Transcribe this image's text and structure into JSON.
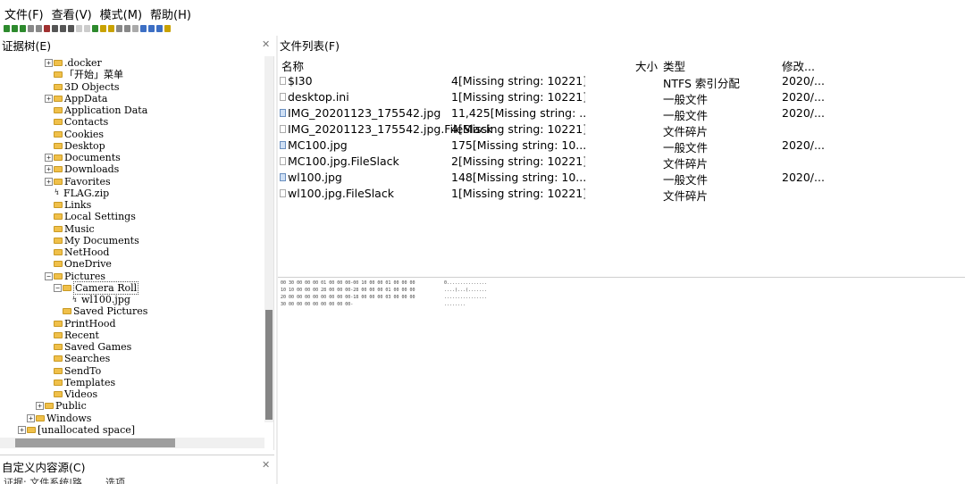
{
  "menubar": {
    "items": [
      "文件(F)",
      "查看(V)",
      "模式(M)",
      "帮助(H)"
    ]
  },
  "toolbar": {
    "buttons": [
      {
        "icon": "home-icon",
        "color": "#2d8a2d"
      },
      {
        "icon": "back-icon",
        "color": "#2d8a2d"
      },
      {
        "icon": "forward-icon",
        "color": "#2d8a2d"
      },
      {
        "icon": "copy-icon",
        "color": "#888888"
      },
      {
        "icon": "search-icon",
        "color": "#888888"
      },
      {
        "icon": "find-icon",
        "color": "#a03030"
      },
      {
        "icon": "save-icon",
        "color": "#555555"
      },
      {
        "icon": "export-icon",
        "color": "#555555"
      },
      {
        "icon": "print-icon",
        "color": "#555555"
      },
      {
        "icon": "cloud-icon",
        "color": "#cccccc"
      },
      {
        "icon": "arrow-icon",
        "color": "#cccccc"
      },
      {
        "icon": "bar-icon",
        "color": "#2d8a2d"
      },
      {
        "icon": "bookmark-icon",
        "color": "#c9a200"
      },
      {
        "icon": "pencil-icon",
        "color": "#c9a200"
      },
      {
        "icon": "page-icon",
        "color": "#888888"
      },
      {
        "icon": "page2-icon",
        "color": "#888888"
      },
      {
        "icon": "page3-icon",
        "color": "#aaaaaa"
      },
      {
        "icon": "view-hex-icon",
        "color": "#3d6fc4"
      },
      {
        "icon": "sort-icon",
        "color": "#3d6fc4"
      },
      {
        "icon": "sort2-icon",
        "color": "#3d6fc4"
      },
      {
        "icon": "filter-icon",
        "color": "#c9a200"
      }
    ]
  },
  "evidence_tree": {
    "title": "证据树(E)",
    "items": [
      {
        "label": ".docker",
        "expander": "+",
        "kind": "folder"
      },
      {
        "label": "「开始」菜单",
        "expander": "",
        "kind": "folder"
      },
      {
        "label": "3D Objects",
        "expander": "",
        "kind": "folder"
      },
      {
        "label": "AppData",
        "expander": "+",
        "kind": "folder"
      },
      {
        "label": "Application Data",
        "expander": "",
        "kind": "folder"
      },
      {
        "label": "Contacts",
        "expander": "",
        "kind": "folder"
      },
      {
        "label": "Cookies",
        "expander": "",
        "kind": "folder"
      },
      {
        "label": "Desktop",
        "expander": "",
        "kind": "folder"
      },
      {
        "label": "Documents",
        "expander": "+",
        "kind": "folder"
      },
      {
        "label": "Downloads",
        "expander": "+",
        "kind": "folder"
      },
      {
        "label": "Favorites",
        "expander": "+",
        "kind": "folder"
      },
      {
        "label": "FLAG.zip",
        "expander": "",
        "kind": "file"
      },
      {
        "label": "Links",
        "expander": "",
        "kind": "folder"
      },
      {
        "label": "Local Settings",
        "expander": "",
        "kind": "folder"
      },
      {
        "label": "Music",
        "expander": "",
        "kind": "folder"
      },
      {
        "label": "My Documents",
        "expander": "",
        "kind": "folder"
      },
      {
        "label": "NetHood",
        "expander": "",
        "kind": "folder"
      },
      {
        "label": "OneDrive",
        "expander": "",
        "kind": "folder"
      },
      {
        "label": "Pictures",
        "expander": "−",
        "kind": "folder"
      },
      {
        "label": "Camera Roll",
        "expander": "−",
        "kind": "folder"
      },
      {
        "label": "wl100.jpg",
        "expander": "",
        "kind": "file"
      },
      {
        "label": "Saved Pictures",
        "expander": "",
        "kind": "folder"
      },
      {
        "label": "PrintHood",
        "expander": "",
        "kind": "folder"
      },
      {
        "label": "Recent",
        "expander": "",
        "kind": "folder"
      },
      {
        "label": "Saved Games",
        "expander": "",
        "kind": "folder"
      },
      {
        "label": "Searches",
        "expander": "",
        "kind": "folder"
      },
      {
        "label": "SendTo",
        "expander": "",
        "kind": "folder"
      },
      {
        "label": "Templates",
        "expander": "",
        "kind": "folder"
      },
      {
        "label": "Videos",
        "expander": "",
        "kind": "folder"
      },
      {
        "label": "Public",
        "expander": "+",
        "kind": "folder"
      },
      {
        "label": "Windows",
        "expander": "+",
        "kind": "folder"
      },
      {
        "label": "[unallocated space]",
        "expander": "+",
        "kind": "folder"
      }
    ]
  },
  "file_list": {
    "title": "文件列表(F)",
    "columns": {
      "name": "名称",
      "size": "大小",
      "type": "类型",
      "modified": "修改..."
    },
    "rows": [
      {
        "icon": "file-icon",
        "name": "$I30",
        "size": "4[Missing string: 10221]",
        "type": "NTFS 索引分配",
        "modified": "2020/..."
      },
      {
        "icon": "file-icon",
        "name": "desktop.ini",
        "size": "1[Missing string: 10221]",
        "type": "一般文件",
        "modified": "2020/..."
      },
      {
        "icon": "image-icon",
        "name": "IMG_20201123_175542.jpg",
        "size": "11,425[Missing string: ...",
        "type": "一般文件",
        "modified": "2020/..."
      },
      {
        "icon": "file-icon",
        "name": "IMG_20201123_175542.jpg.FileSlack",
        "size": "4[Missing string: 10221]",
        "type": "文件碎片",
        "modified": ""
      },
      {
        "icon": "image-icon",
        "name": "MC100.jpg",
        "size": "175[Missing string: 10...",
        "type": "一般文件",
        "modified": "2020/..."
      },
      {
        "icon": "file-icon",
        "name": "MC100.jpg.FileSlack",
        "size": "2[Missing string: 10221]",
        "type": "文件碎片",
        "modified": ""
      },
      {
        "icon": "image-icon",
        "name": "wl100.jpg",
        "size": "148[Missing string: 10...",
        "type": "一般文件",
        "modified": "2020/..."
      },
      {
        "icon": "file-icon",
        "name": "wl100.jpg.FileSlack",
        "size": "1[Missing string: 10221]",
        "type": "文件碎片",
        "modified": ""
      }
    ]
  },
  "hex_view": {
    "lines": [
      {
        "offset": "00",
        "hex": "30 00 00 00 01 00 00 00-00 10 00 00 01 00 00 00",
        "ascii": "0..............."
      },
      {
        "offset": "10",
        "hex": "10 00 00 00 28 00 00 00-28 00 00 00 01 00 00 00",
        "ascii": "....(...(......."
      },
      {
        "offset": "20",
        "hex": "00 00 00 00 00 00 00 00-18 00 00 00 03 00 00 00",
        "ascii": "................"
      },
      {
        "offset": "30",
        "hex": "00 00 00 00 00 00 00 00-",
        "ascii": "........"
      }
    ]
  },
  "custom_content": {
    "title": "自定义内容源(C)",
    "columns": [
      "证据: 文件系统|路...",
      "选项"
    ]
  }
}
